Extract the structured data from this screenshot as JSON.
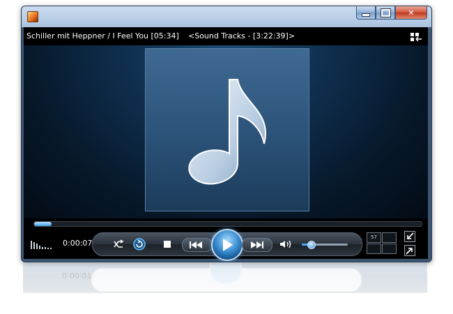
{
  "window": {
    "title": "",
    "app_icon": "media-player-icon",
    "buttons": {
      "minimize": "minimize-icon",
      "maximize": "maximize-icon",
      "close": "close-icon"
    }
  },
  "info_bar": {
    "track": "Schiller mit Heppner / I Feel You  [05:34]",
    "playlist": "<Sound Tracks - [3:22:39]>"
  },
  "side_buttons": [
    "layout-icon",
    "playlist-icon"
  ],
  "now_playing": {
    "art_icon": "music-note-icon"
  },
  "playback": {
    "elapsed": "0:00:07",
    "seek_progress": 0.02,
    "volume": 0.2
  },
  "controls": {
    "shuffle": "shuffle-icon",
    "repeat": "repeat-icon",
    "stop": "stop-icon",
    "previous": "previous-icon",
    "play": "play-icon",
    "next": "next-icon",
    "volume": "speaker-icon"
  },
  "mini_display": {
    "value": "57"
  },
  "corner_buttons": [
    "minimize-to-mini-icon",
    "fullscreen-icon"
  ],
  "colors": {
    "accent": "#3d8fd2",
    "frame": "#a9c1de",
    "background": "#000000"
  }
}
